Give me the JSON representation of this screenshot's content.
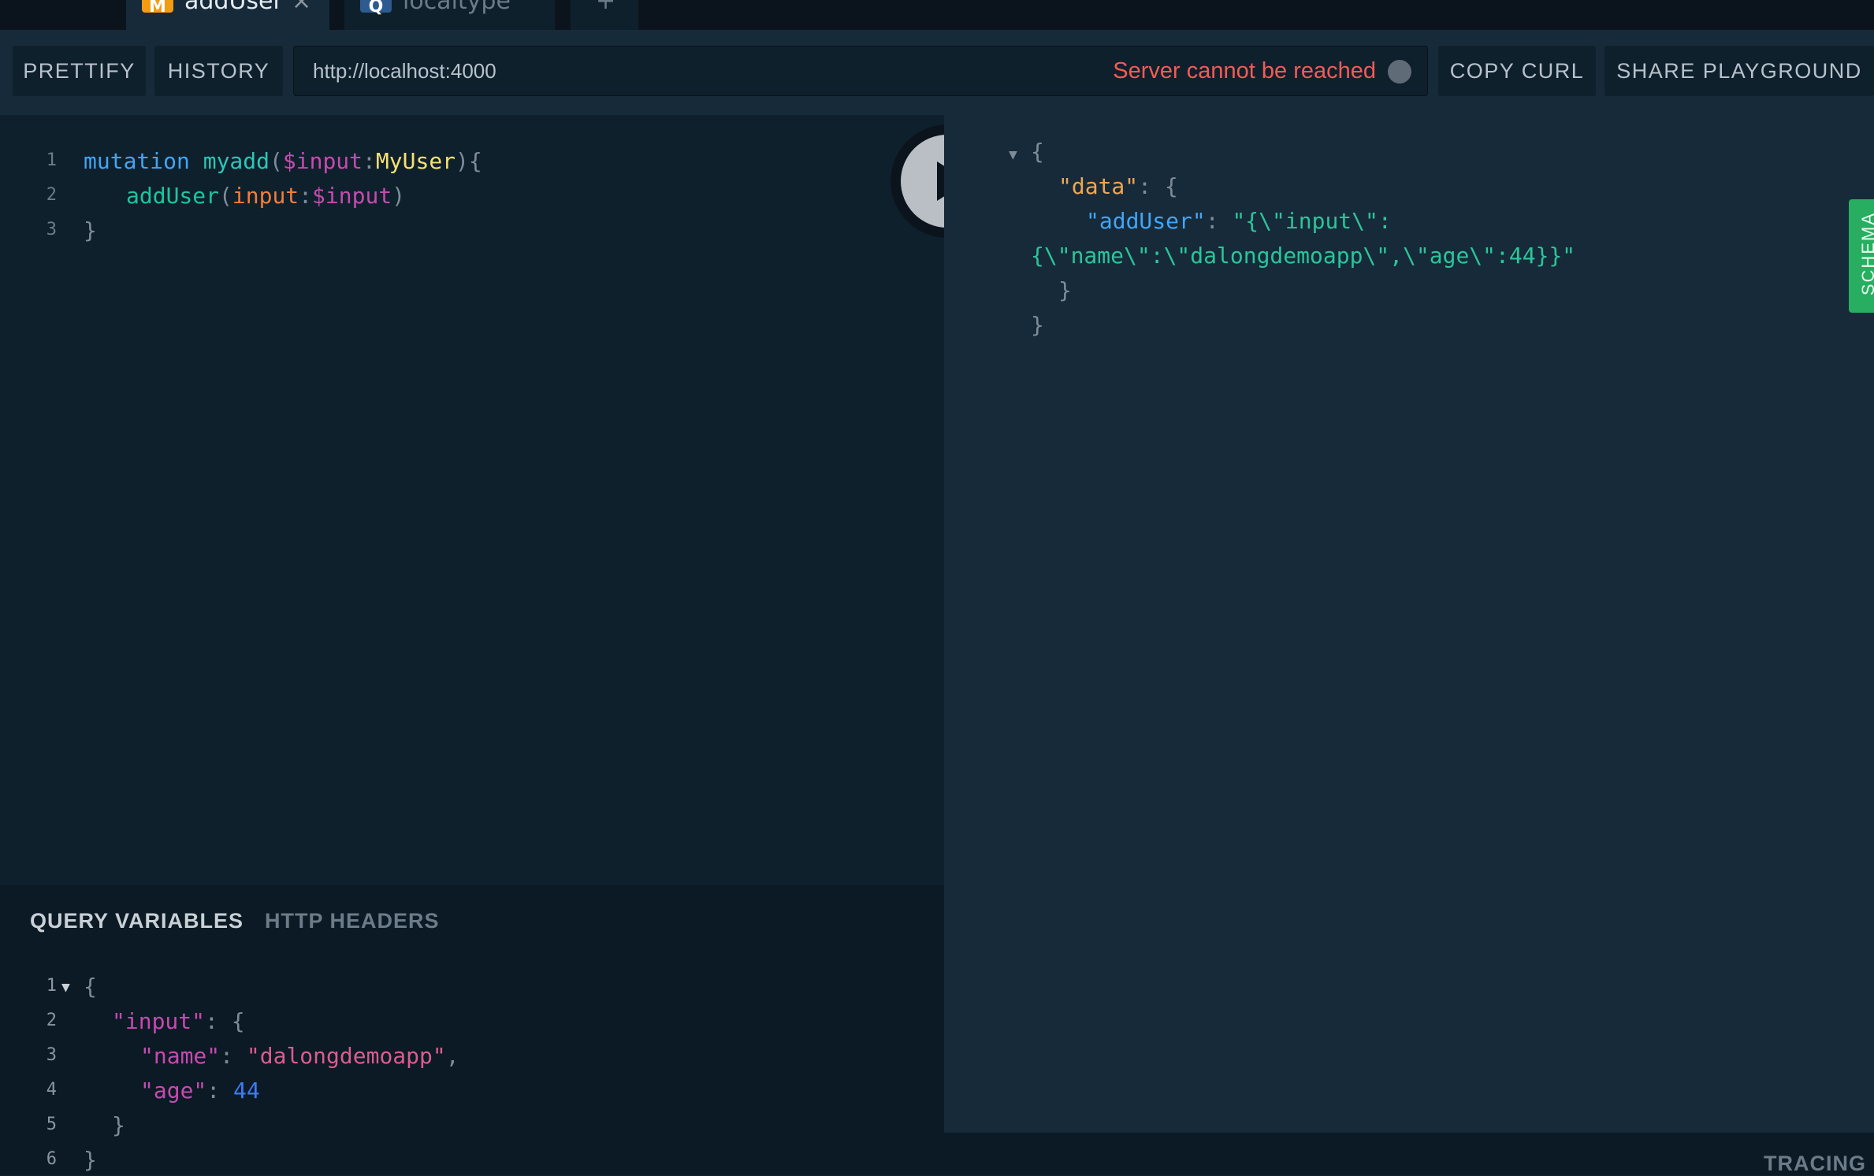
{
  "tabs": [
    {
      "badge": "M",
      "title": "addUser",
      "close": "×",
      "badge_color": "#f39c12"
    },
    {
      "badge": "Q",
      "title": "localtype",
      "badge_color": "#2d5a8f"
    },
    {
      "label": "+"
    }
  ],
  "toolbar": {
    "prettify": "PRETTIFY",
    "history": "HISTORY",
    "url": "http://localhost:4000",
    "status": "Server cannot be reached",
    "copy_curl": "COPY CURL",
    "share": "SHARE PLAYGROUND"
  },
  "editor": {
    "line_numbers": [
      "1",
      "2",
      "3"
    ],
    "tokens": {
      "mutation": "mutation",
      "op_name": "myadd",
      "open_paren": "(",
      "var": "$input",
      "colon": ":",
      "type": "MyUser",
      "close_brace": "){",
      "field": "addUser",
      "paren2": "(",
      "arg": "input",
      "colon2": ":",
      "var2": "$input",
      "close_paren": ")",
      "end_brace": "}"
    }
  },
  "result": {
    "open": "{",
    "data_key": "\"data\"",
    "colon": ": {",
    "adduser_key": "\"addUser\"",
    "colon2": ": ",
    "value_line1": "\"{\\\"input\\\":",
    "value_line2": "{\\\"name\\\":\\\"dalongdemoapp\\\",\\\"age\\\":44}}\"",
    "inner_close": "}",
    "close": "}"
  },
  "schema_label": "SCHEMA",
  "variables": {
    "tab_query": "QUERY VARIABLES",
    "tab_headers": "HTTP HEADERS",
    "line_numbers": [
      "1",
      "2",
      "3",
      "4",
      "5",
      "6"
    ],
    "tokens": {
      "open": "{",
      "input_key": "\"input\"",
      "colon_open": ": {",
      "name_key": "\"name\"",
      "colon": ": ",
      "name_value": "\"dalongdemoapp\"",
      "comma": ",",
      "age_key": "\"age\"",
      "age_value": "44",
      "inner_close": "}",
      "close": "}"
    }
  },
  "footer": {
    "tracing": "TRACING"
  }
}
